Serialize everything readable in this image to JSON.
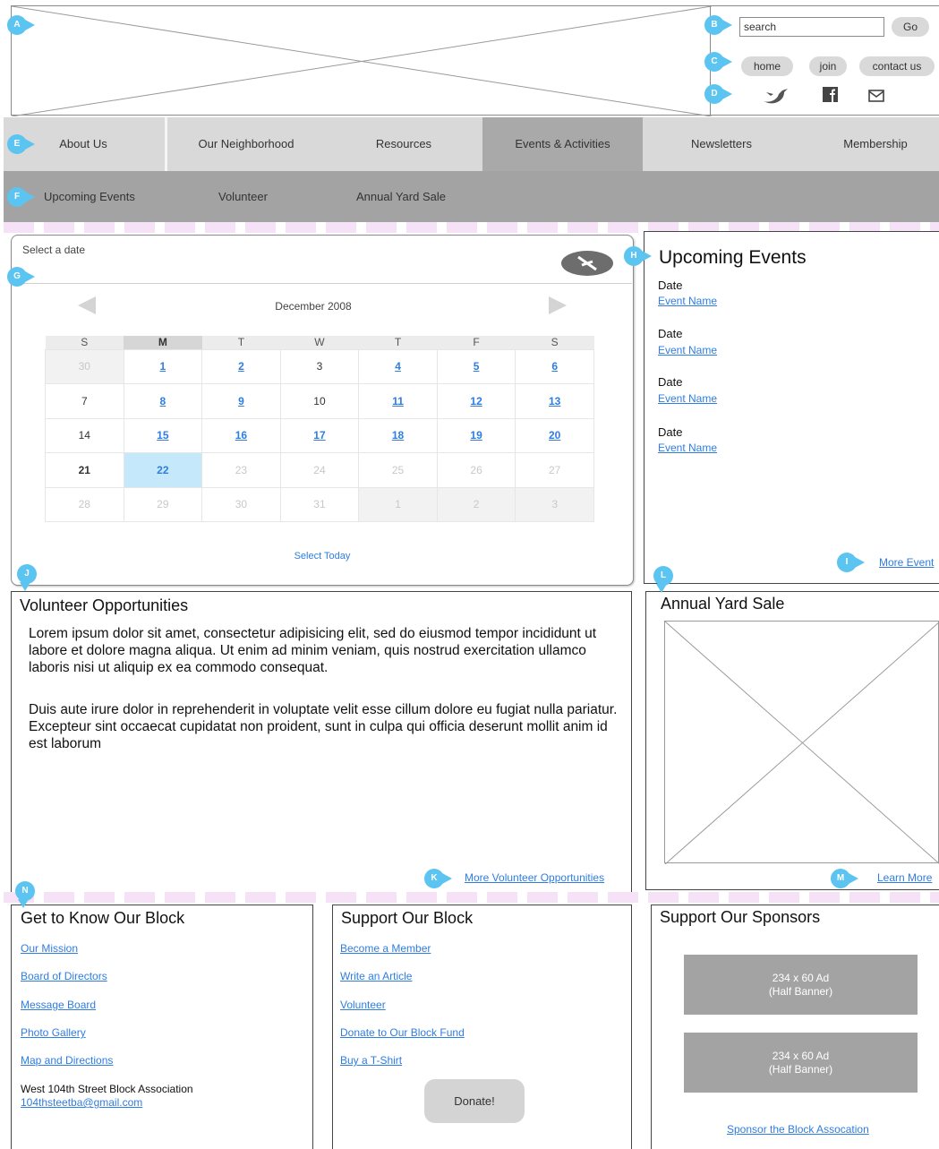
{
  "annotations": [
    "A",
    "B",
    "C",
    "D",
    "E",
    "F",
    "G",
    "H",
    "I",
    "J",
    "K",
    "L",
    "M",
    "N"
  ],
  "header": {
    "search_placeholder": "search",
    "search_value": "search",
    "go_label": "Go",
    "utility_links": [
      "home",
      "join",
      "contact us"
    ],
    "social_icons": [
      "twitter-icon",
      "facebook-icon",
      "email-icon"
    ]
  },
  "nav": {
    "items": [
      "About Us",
      "Our Neighborhood",
      "Resources",
      "Events & Activities",
      "Newsletters",
      "Membership"
    ],
    "active": "Events & Activities"
  },
  "subnav": {
    "items": [
      "Upcoming Events",
      "Volunteer",
      "Annual Yard Sale"
    ]
  },
  "calendar": {
    "label": "Select a date",
    "month": "December 2008",
    "weekdays": [
      "S",
      "M",
      "T",
      "W",
      "T",
      "F",
      "S"
    ],
    "weeks": [
      [
        "30",
        "1",
        "2",
        "3",
        "4",
        "5",
        "6"
      ],
      [
        "7",
        "8",
        "9",
        "10",
        "11",
        "12",
        "13"
      ],
      [
        "14",
        "15",
        "16",
        "17",
        "18",
        "19",
        "20"
      ],
      [
        "21",
        "22",
        "23",
        "24",
        "25",
        "26",
        "27"
      ],
      [
        "28",
        "29",
        "30",
        "31",
        "1",
        "2",
        "3"
      ]
    ],
    "selected": "22",
    "select_today": "Select Today"
  },
  "events": {
    "title": "Upcoming Events",
    "items": [
      {
        "date": "Date",
        "name": "Event Name"
      },
      {
        "date": "Date",
        "name": "Event Name"
      },
      {
        "date": "Date",
        "name": "Event Name"
      },
      {
        "date": "Date",
        "name": "Event Name"
      }
    ],
    "more": "More Event"
  },
  "volunteer": {
    "title": "Volunteer Opportunities",
    "p1": "Lorem ipsum dolor sit amet, consectetur adipisicing elit, sed do eiusmod tempor incididunt ut labore et dolore magna aliqua. Ut enim ad minim veniam, quis nostrud exercitation ullamco laboris nisi ut aliquip ex ea commodo consequat.",
    "p2": "Duis aute irure dolor in reprehenderit in voluptate velit esse cillum dolore eu fugiat nulla pariatur. Excepteur sint occaecat cupidatat non proident, sunt in culpa qui officia deserunt mollit anim id est laborum",
    "more": "More Volunteer Opportunities"
  },
  "yard_sale": {
    "title": "Annual Yard Sale",
    "more": "Learn More"
  },
  "know_block": {
    "title": "Get to Know Our Block",
    "links": [
      "Our Mission",
      "Board of Directors",
      "Message Board",
      "Photo Gallery",
      "Map and Directions"
    ],
    "org_name": "West 104th Street Block Association",
    "email": "104thsteetba@gmail.com"
  },
  "support_block": {
    "title": "Support Our Block",
    "links": [
      "Become a Member",
      "Write an Article",
      "Volunteer",
      "Donate to Our Block Fund",
      "Buy a T-Shirt"
    ],
    "donate": "Donate!"
  },
  "sponsors": {
    "title": "Support Our Sponsors",
    "ads": [
      {
        "line1": "234 x 60 Ad",
        "line2": "(Half Banner)"
      },
      {
        "line1": "234 x 60 Ad",
        "line2": "(Half Banner)"
      }
    ],
    "link": "Sponsor the Block Assocation"
  },
  "colors": {
    "annotation": "#5bc4f1",
    "link": "#2f7de1",
    "nav_bg": "#d9d9d9",
    "nav_active": "#a9a9a9",
    "subnav_bg": "#a3a3a3",
    "selected_day": "#c5e9fb"
  }
}
